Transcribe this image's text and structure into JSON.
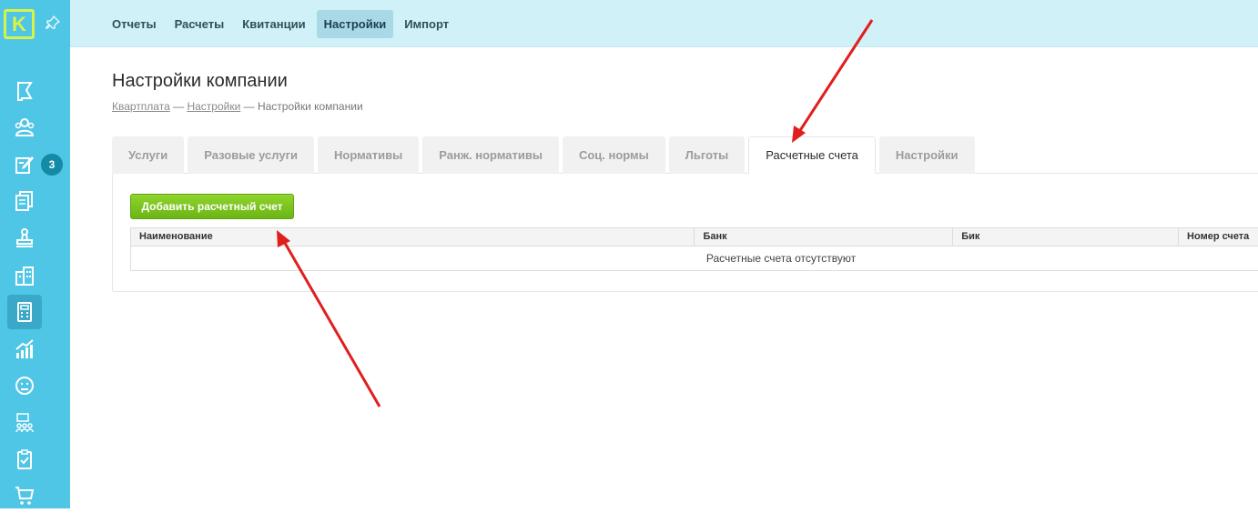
{
  "logo_letter": "K",
  "notification_count": "3",
  "topnav": [
    "Отчеты",
    "Расчеты",
    "Квитанции",
    "Настройки",
    "Импорт"
  ],
  "page_title": "Настройки компании",
  "breadcrumb": {
    "link1": "Квартплата",
    "sep": " — ",
    "link2": "Настройки",
    "current": "Настройки компании"
  },
  "tabs": [
    "Услуги",
    "Разовые услуги",
    "Нормативы",
    "Ранж. нормативы",
    "Соц. нормы",
    "Льготы",
    "Расчетные счета",
    "Настройки"
  ],
  "add_button_label": "Добавить расчетный счет",
  "table": {
    "columns": [
      "Наименование",
      "Банк",
      "Бик",
      "Номер счета"
    ],
    "empty_text": "Расчетные счета отсутствуют"
  },
  "colors": {
    "sidebar": "#4fc6e6",
    "topbar": "#d1f1f8",
    "accent_green": "#7cc520",
    "logo": "#d8f24a",
    "arrow": "#e01e1e"
  },
  "sidebar_icons": [
    "flag-icon",
    "users-icon",
    "edit-icon",
    "documents-icon",
    "stamp-icon",
    "building-icon",
    "calculator-icon",
    "chart-icon",
    "sad-face-icon",
    "team-icon",
    "clipboard-check-icon",
    "cart-icon"
  ]
}
